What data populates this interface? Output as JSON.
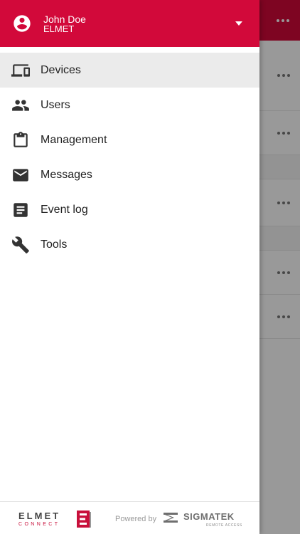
{
  "user": {
    "name": "John Doe",
    "organization": "ELMET"
  },
  "nav": {
    "items": [
      {
        "label": "Devices",
        "icon": "devices-icon",
        "active": true
      },
      {
        "label": "Users",
        "icon": "users-icon",
        "active": false
      },
      {
        "label": "Management",
        "icon": "clipboard-icon",
        "active": false
      },
      {
        "label": "Messages",
        "icon": "mail-icon",
        "active": false
      },
      {
        "label": "Event log",
        "icon": "event-log-icon",
        "active": false
      },
      {
        "label": "Tools",
        "icon": "wrench-icon",
        "active": false
      }
    ]
  },
  "footer": {
    "brand": "ELMET",
    "brand_sub": "CONNECT",
    "powered_by": "Powered by",
    "partner": "SIGMATEK",
    "partner_sub": "REMOTE ACCESS"
  },
  "colors": {
    "accent": "#d2093a",
    "active_item_bg": "#ebebeb",
    "icon": "#333333"
  }
}
